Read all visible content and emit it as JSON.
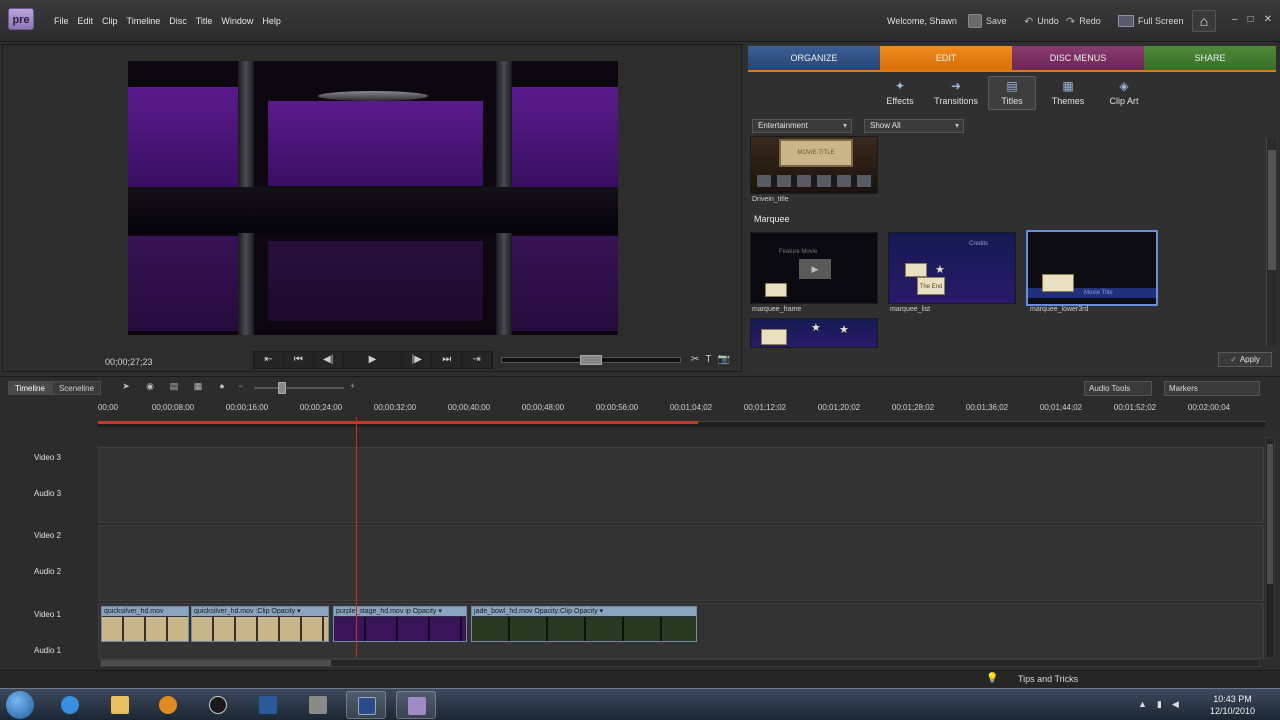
{
  "app": {
    "logo_text": "pre",
    "menus": [
      "File",
      "Edit",
      "Clip",
      "Timeline",
      "Disc",
      "Title",
      "Window",
      "Help"
    ],
    "welcome": "Welcome, Shawn",
    "toolbar": {
      "save": "Save",
      "undo": "Undo",
      "redo": "Redo",
      "fullscreen": "Full Screen"
    },
    "window_controls": [
      "–",
      "□",
      "✕"
    ]
  },
  "monitor": {
    "timecode": "00;00;27;23",
    "transport": [
      "⇤",
      "⏮",
      "◀|",
      "▶",
      "|▶",
      "⏭",
      "⇥"
    ],
    "tools": [
      "✂",
      "T",
      "📷"
    ]
  },
  "panel": {
    "tabs": [
      "ORGANIZE",
      "EDIT",
      "DISC MENUS",
      "SHARE"
    ],
    "subtools": [
      {
        "label": "Effects",
        "icon": "effects-icon",
        "glyph": "✦"
      },
      {
        "label": "Transitions",
        "icon": "transitions-icon",
        "glyph": "➜"
      },
      {
        "label": "Titles",
        "icon": "titles-icon",
        "glyph": "▤"
      },
      {
        "label": "Themes",
        "icon": "themes-icon",
        "glyph": "▦"
      },
      {
        "label": "Clip Art",
        "icon": "clip-art-icon",
        "glyph": "◈"
      }
    ],
    "category": "Entertainment",
    "filter": "Show All",
    "items": {
      "drivein": {
        "label": "Drivein_title",
        "card": "MOVIE TITLE"
      },
      "section": "Marquee",
      "frame": {
        "label": "marquee_frame",
        "text1": "Feature Movie"
      },
      "list": {
        "label": "marquee_list",
        "text1": "Credits",
        "text2": "The End"
      },
      "lower3rd": {
        "label": "marquee_lower3rd",
        "text1": "Movie Title"
      }
    },
    "apply": "Apply"
  },
  "timeline": {
    "tabs": [
      "Timeline",
      "Sceneline"
    ],
    "zoom_minus": "−",
    "zoom_plus": "+",
    "audio_tools": "Audio Tools",
    "markers": "Markers",
    "ruler": [
      "00;00",
      "00;00;08;00",
      "00;00;16;00",
      "00;00;24;00",
      "00;00;32;00",
      "00;00;40;00",
      "00;00;48;00",
      "00;00;56;00",
      "00;01;04;02",
      "00;01;12;02",
      "00;01;20;02",
      "00;01;28;02",
      "00;01;36;02",
      "00;01;44;02",
      "00;01;52;02",
      "00;02;00;04"
    ],
    "tracks": [
      "Video 3",
      "Audio 3",
      "Video 2",
      "Audio 2",
      "Video 1",
      "Audio 1"
    ],
    "clips": [
      {
        "title": "quicksilver_hd.mov",
        "color": "#b7a37a"
      },
      {
        "title": "quicksilver_hd.mov :Clip Opacity ▾",
        "color": "#b7a37a"
      },
      {
        "title": "purple_stage_hd.mov ip Opacity ▾",
        "color": "#4a1e6e"
      },
      {
        "title": "jade_bowl_hd.mov  Opacity:Clip Opacity ▾",
        "color": "#2f4a2a"
      }
    ]
  },
  "status": {
    "tips": "Tips and Tricks"
  },
  "taskbar": {
    "time": "10:43 PM",
    "date": "12/10/2010",
    "items": [
      "internet-explorer-icon",
      "folder-icon",
      "media-player-icon",
      "hp-icon",
      "checkmark-app-icon",
      "blank-app-icon",
      "remote-app-icon",
      "premiere-elements-icon"
    ]
  },
  "colors": {
    "accent_edit": "#e07a10",
    "organize": "#2f5288",
    "disc": "#7a2f60",
    "share": "#437a30",
    "playhead": "#d02a2a"
  }
}
